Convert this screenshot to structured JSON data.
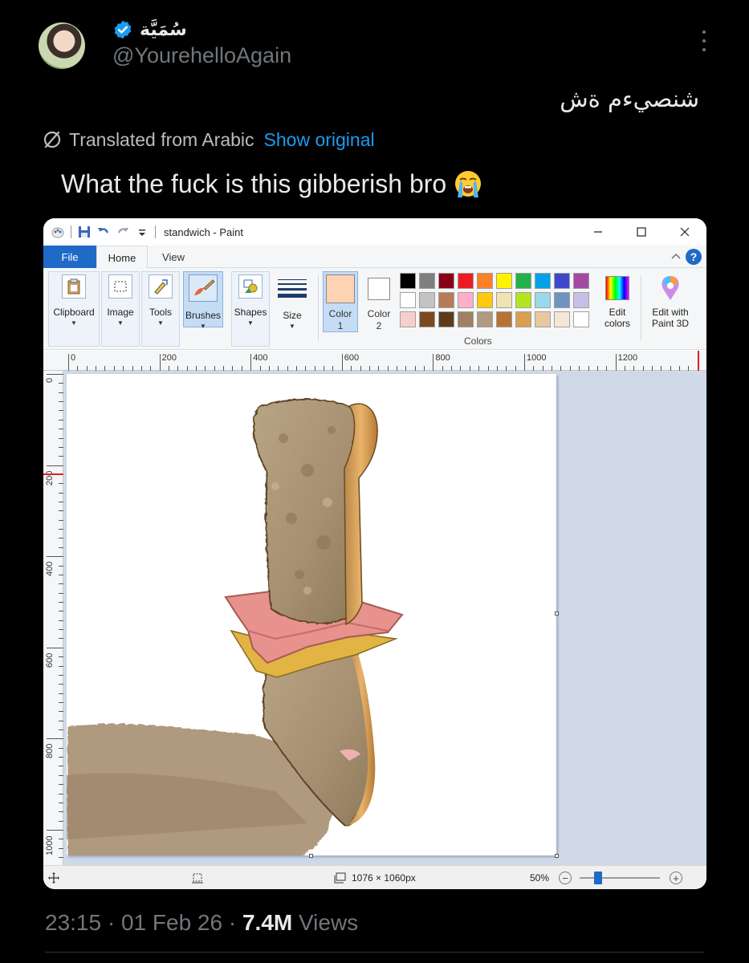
{
  "tweet": {
    "display_name": "سُمَيَّة",
    "handle": "@YourehelloAgain",
    "text_original": "شنصيءم ةش",
    "translated_label": "Translated from Arabic",
    "show_original": "Show original",
    "translation": "What the fuck is this gibberish bro",
    "emoji": "loudly-crying-face",
    "time": "23:15",
    "date": "01 Feb 26",
    "views_count": "7.4M",
    "views_label": "Views",
    "verified_color": "#1d9bf0"
  },
  "paint": {
    "window_title": "standwich - Paint",
    "tabs": [
      "File",
      "Home",
      "View"
    ],
    "tools": {
      "clipboard": "Clipboard",
      "image": "Image",
      "tools": "Tools",
      "brushes": "Brushes",
      "shapes": "Shapes",
      "size": "Size"
    },
    "color1": {
      "line1": "Color",
      "line2": "1",
      "value": "#fdd3b3"
    },
    "color2": {
      "line1": "Color",
      "line2": "2",
      "value": "#ffffff"
    },
    "edit_colors": {
      "line1": "Edit",
      "line2": "colors"
    },
    "edit_3d": {
      "line1": "Edit with",
      "line2": "Paint 3D"
    },
    "colors_label": "Colors",
    "palette": [
      "#000000",
      "#7f7f7f",
      "#880015",
      "#ed1c24",
      "#ff7f27",
      "#fff200",
      "#22b14c",
      "#00a2e8",
      "#3f48cc",
      "#a349a4",
      "#ffffff",
      "#c3c3c3",
      "#b97a57",
      "#ffaec9",
      "#ffc90e",
      "#efe4b0",
      "#b5e61d",
      "#99d9ea",
      "#7092be",
      "#c8bfe7",
      "#f6cfcb",
      "#7b4a1f",
      "#5c3d1a",
      "#a08060",
      "#b09a80",
      "#b87333",
      "#d9a050",
      "#e8c8a0",
      "#f6e6d6",
      "#ffffff"
    ],
    "ruler_h": [
      "0",
      "200",
      "400",
      "600",
      "800",
      "1000",
      "1200"
    ],
    "ruler_v": [
      "0",
      "200",
      "400",
      "600",
      "800",
      "1000"
    ],
    "canvas_size": "1076 × 1060px",
    "zoom": "50%"
  }
}
